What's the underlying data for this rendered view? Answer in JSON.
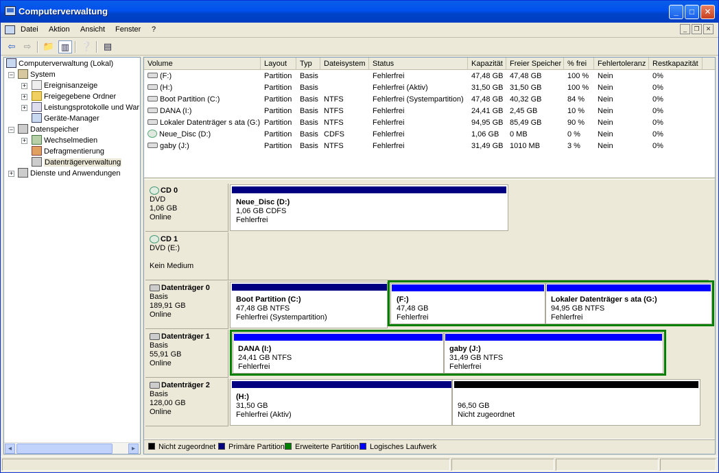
{
  "window": {
    "title": "Computerverwaltung"
  },
  "menu": [
    "Datei",
    "Aktion",
    "Ansicht",
    "Fenster",
    "?"
  ],
  "tree": {
    "root": "Computerverwaltung (Lokal)",
    "system": "System",
    "ereignis": "Ereignisanzeige",
    "freigabe": "Freigegebene Ordner",
    "leistung": "Leistungsprotokolle und Warı",
    "geraete": "Geräte-Manager",
    "daten": "Datenspeicher",
    "wechsel": "Wechselmedien",
    "defrag": "Defragmentierung",
    "dtv": "Datenträgerverwaltung",
    "dienste": "Dienste und Anwendungen"
  },
  "columns": [
    "Volume",
    "Layout",
    "Typ",
    "Dateisystem",
    "Status",
    "Kapazität",
    "Freier Speicher",
    "% frei",
    "Fehlertoleranz",
    "Restkapazität"
  ],
  "volumes": [
    {
      "name": "(F:)",
      "layout": "Partition",
      "type": "Basis",
      "fs": "",
      "status": "Fehlerfrei",
      "cap": "47,48 GB",
      "free": "47,48 GB",
      "pct": "100 %",
      "ft": "Nein",
      "rest": "0%"
    },
    {
      "name": "(H:)",
      "layout": "Partition",
      "type": "Basis",
      "fs": "",
      "status": "Fehlerfrei (Aktiv)",
      "cap": "31,50 GB",
      "free": "31,50 GB",
      "pct": "100 %",
      "ft": "Nein",
      "rest": "0%"
    },
    {
      "name": "Boot Partition (C:)",
      "layout": "Partition",
      "type": "Basis",
      "fs": "NTFS",
      "status": "Fehlerfrei (Systempartition)",
      "cap": "47,48 GB",
      "free": "40,32 GB",
      "pct": "84 %",
      "ft": "Nein",
      "rest": "0%"
    },
    {
      "name": "DANA (I:)",
      "layout": "Partition",
      "type": "Basis",
      "fs": "NTFS",
      "status": "Fehlerfrei",
      "cap": "24,41 GB",
      "free": "2,45 GB",
      "pct": "10 %",
      "ft": "Nein",
      "rest": "0%"
    },
    {
      "name": "Lokaler Datenträger s ata (G:)",
      "layout": "Partition",
      "type": "Basis",
      "fs": "NTFS",
      "status": "Fehlerfrei",
      "cap": "94,95 GB",
      "free": "85,49 GB",
      "pct": "90 %",
      "ft": "Nein",
      "rest": "0%"
    },
    {
      "name": "Neue_Disc (D:)",
      "layout": "Partition",
      "type": "Basis",
      "fs": "CDFS",
      "status": "Fehlerfrei",
      "cap": "1,06 GB",
      "free": "0 MB",
      "pct": "0 %",
      "ft": "Nein",
      "rest": "0%"
    },
    {
      "name": "gaby (J:)",
      "layout": "Partition",
      "type": "Basis",
      "fs": "NTFS",
      "status": "Fehlerfrei",
      "cap": "31,49 GB",
      "free": "1010 MB",
      "pct": "3 %",
      "ft": "Nein",
      "rest": "0%"
    }
  ],
  "disks": {
    "cd0": {
      "name": "CD 0",
      "l1": "DVD",
      "l2": "1,06 GB",
      "l3": "Online"
    },
    "cd1": {
      "name": "CD 1",
      "l1": "DVD (E:)",
      "l3": "Kein Medium"
    },
    "d0": {
      "name": "Datenträger 0",
      "l1": "Basis",
      "l2": "189,91 GB",
      "l3": "Online"
    },
    "d1": {
      "name": "Datenträger 1",
      "l1": "Basis",
      "l2": "55,91 GB",
      "l3": "Online"
    },
    "d2": {
      "name": "Datenträger 2",
      "l1": "Basis",
      "l2": "128,00 GB",
      "l3": "Online"
    }
  },
  "parts": {
    "neue": {
      "name": "Neue_Disc  (D:)",
      "size": "1,06 GB CDFS",
      "status": "Fehlerfrei"
    },
    "boot": {
      "name": "Boot Partition  (C:)",
      "size": "47,48 GB NTFS",
      "status": "Fehlerfrei (Systempartition)"
    },
    "f": {
      "name": "(F:)",
      "size": "47,48 GB",
      "status": "Fehlerfrei"
    },
    "g": {
      "name": "Lokaler Datenträger s ata  (G:)",
      "size": "94,95 GB NTFS",
      "status": "Fehlerfrei"
    },
    "dana": {
      "name": "DANA  (I:)",
      "size": "24,41 GB NTFS",
      "status": "Fehlerfrei"
    },
    "gaby": {
      "name": "gaby  (J:)",
      "size": "31,49 GB NTFS",
      "status": "Fehlerfrei"
    },
    "h": {
      "name": "(H:)",
      "size": "31,50 GB",
      "status": "Fehlerfrei (Aktiv)"
    },
    "unalloc": {
      "size": "96,50 GB",
      "status": "Nicht zugeordnet"
    }
  },
  "legend": [
    "Nicht zugeordnet",
    "Primäre Partition",
    "Erweiterte Partition",
    "Logisches Laufwerk"
  ],
  "colors": {
    "unallocated": "#000000",
    "primary": "#000080",
    "extended": "#008000",
    "logical": "#0000ff"
  }
}
